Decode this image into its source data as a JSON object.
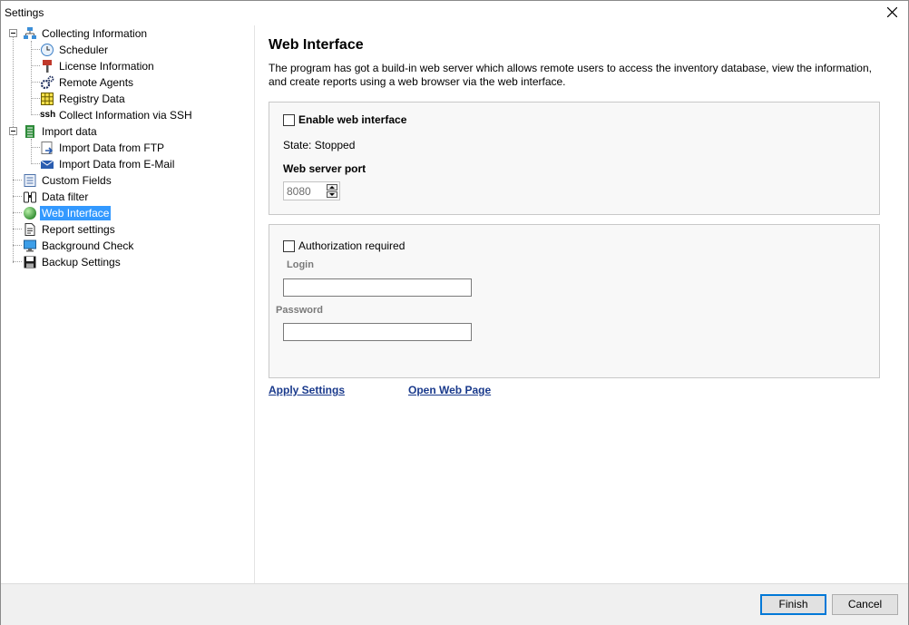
{
  "window": {
    "title": "Settings"
  },
  "tree": {
    "items": [
      {
        "label": "Collecting Information",
        "icon": "network-icon"
      },
      {
        "label": "Scheduler",
        "icon": "clock-icon"
      },
      {
        "label": "License Information",
        "icon": "key-icon"
      },
      {
        "label": "Remote Agents",
        "icon": "gears-icon"
      },
      {
        "label": "Registry Data",
        "icon": "grid-icon"
      },
      {
        "label": "Collect Information via SSH",
        "icon": "ssh-icon",
        "icon_text": "ssh"
      },
      {
        "label": "Import data",
        "icon": "import-icon"
      },
      {
        "label": "Import Data from FTP",
        "icon": "ftp-import-icon"
      },
      {
        "label": "Import Data from E-Mail",
        "icon": "email-import-icon"
      },
      {
        "label": "Custom Fields",
        "icon": "list-icon"
      },
      {
        "label": "Data filter",
        "icon": "binoculars-icon"
      },
      {
        "label": "Web Interface",
        "icon": "globe-icon",
        "selected": true
      },
      {
        "label": "Report settings",
        "icon": "report-icon"
      },
      {
        "label": "Background Check",
        "icon": "monitor-icon"
      },
      {
        "label": "Backup Settings",
        "icon": "floppy-icon"
      }
    ]
  },
  "main": {
    "title": "Web Interface",
    "description": "The program has got a build-in web server which allows remote users to access the inventory database, view the information, and create reports using a web browser via the web interface.",
    "server_group": {
      "enable_label": "Enable web interface",
      "enable_checked": false,
      "state_text": "State: Stopped",
      "port_label": "Web server port",
      "port_value": "8080"
    },
    "auth_group": {
      "auth_label": "Authorization required",
      "auth_checked": false,
      "login_label": "Login",
      "login_value": "",
      "password_label": "Password",
      "password_value": ""
    },
    "apply_link": "Apply Settings",
    "open_link": "Open Web Page"
  },
  "footer": {
    "finish_label": "Finish",
    "cancel_label": "Cancel"
  },
  "colors": {
    "selection": "#3399ff",
    "link": "#1a3a8c",
    "default_button_border": "#0078d7"
  }
}
